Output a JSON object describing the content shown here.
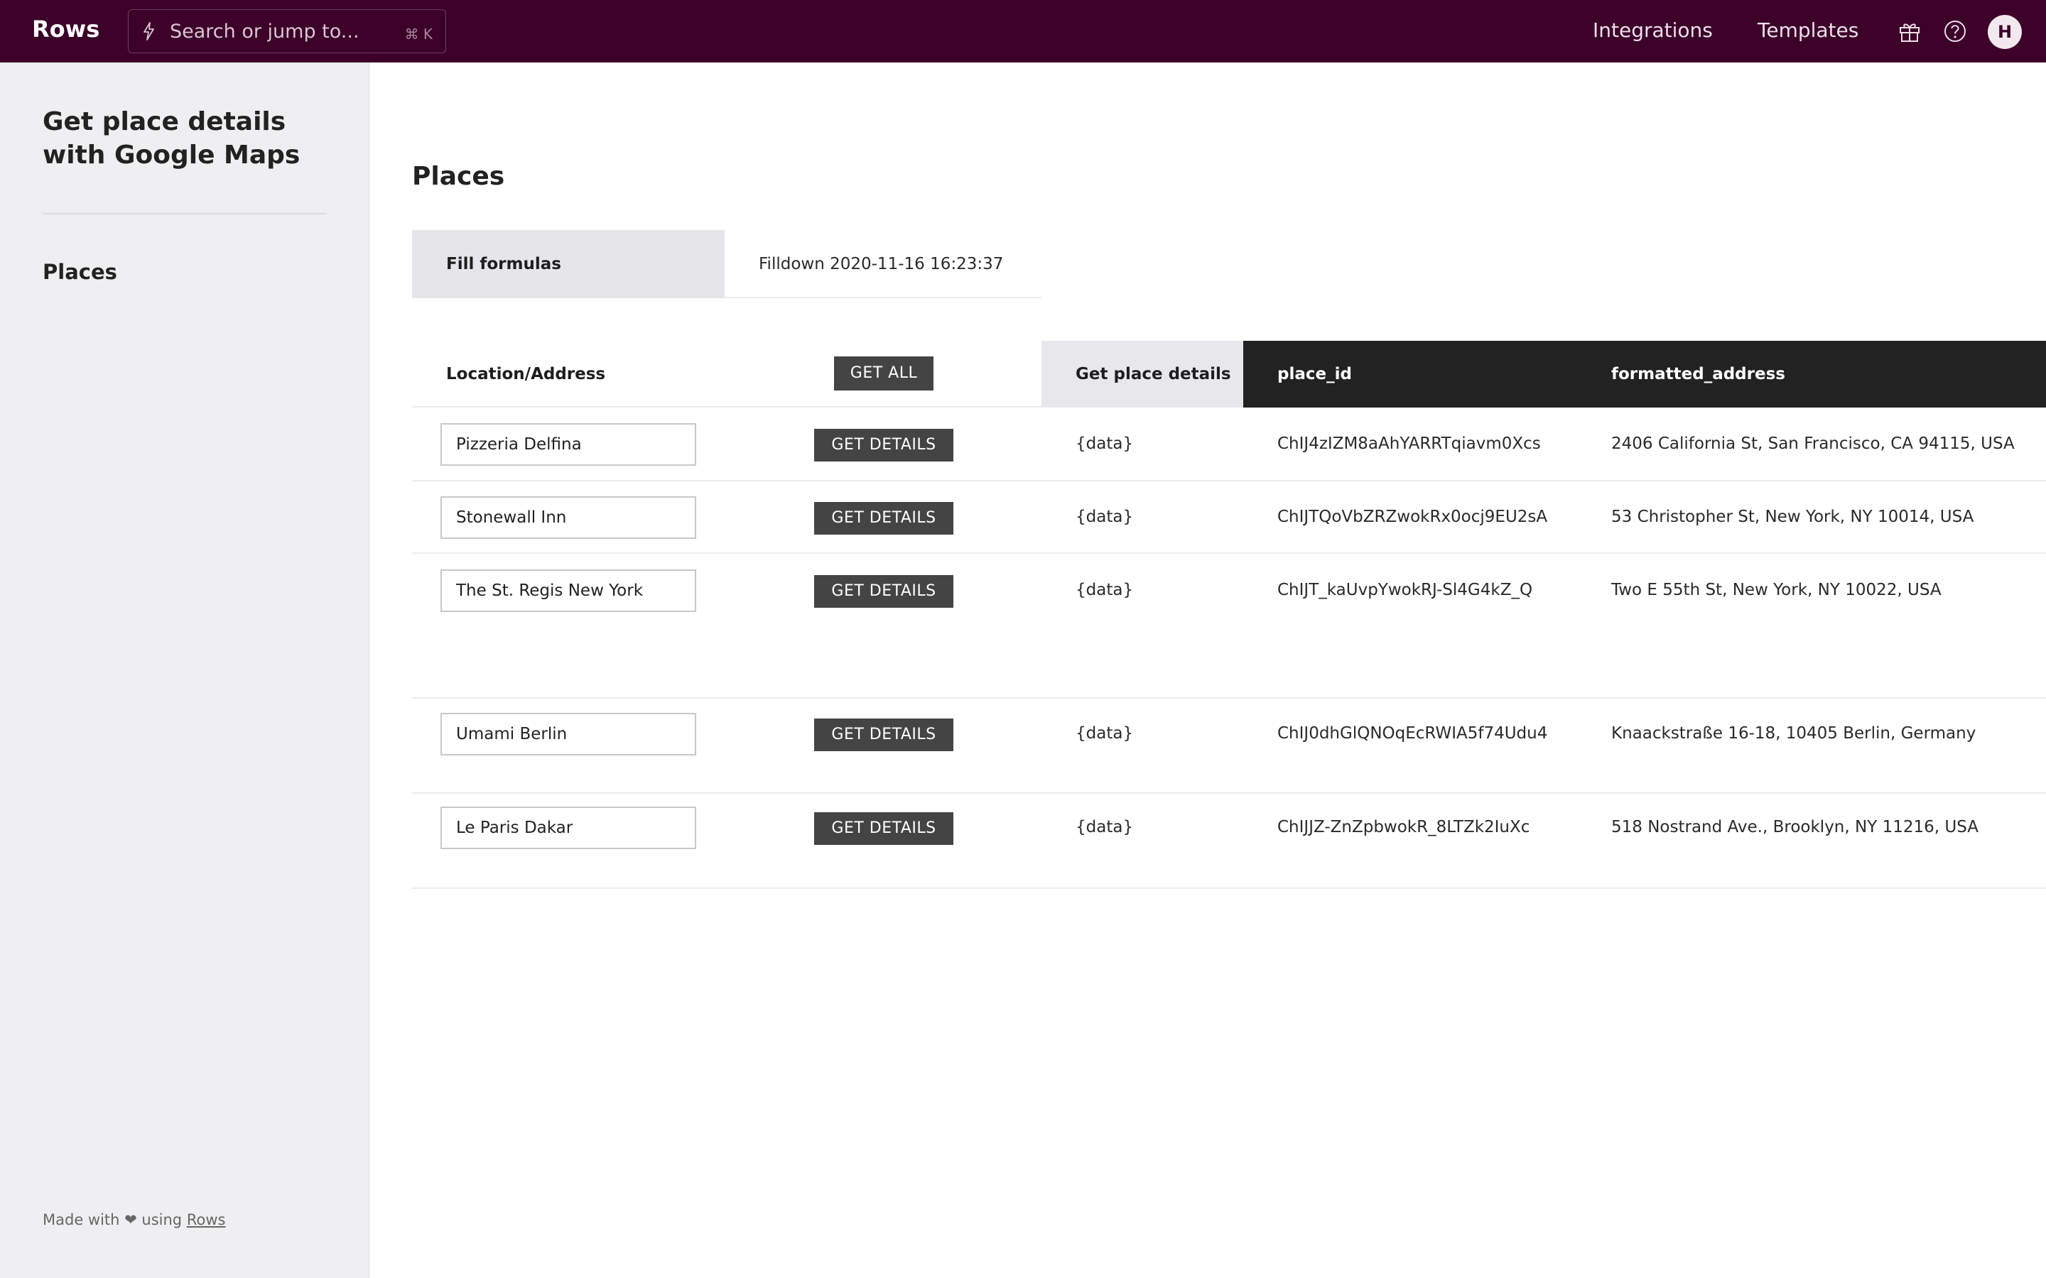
{
  "topbar": {
    "logo": "Rows",
    "search_placeholder": "Search or jump to...",
    "search_shortcut": "⌘ K",
    "nav": [
      "Integrations",
      "Templates"
    ],
    "avatar_initial": "H",
    "bg_color": "#3c0029"
  },
  "sidebar": {
    "title": "Get place details with Google Maps",
    "items": [
      "Places"
    ],
    "footer_prefix": "Made with ❤ using",
    "footer_link": "Rows"
  },
  "main": {
    "section_title": "Places",
    "fill_formulas_label": "Fill formulas",
    "filldown_text": "Filldown 2020-11-16 16:23:37",
    "columns": {
      "location": "Location/Address",
      "get_all": "GET ALL",
      "get_details": "Get place details",
      "place_id": "place_id",
      "formatted_address": "formatted_address"
    },
    "button_label": "GET DETAILS",
    "rows": [
      {
        "location": "Pizzeria Delfina",
        "data": "{data}",
        "place_id": "ChIJ4zIZM8aAhYARRTqiavm0Xcs",
        "address": "2406 California St, San Francisco, CA 94115, USA"
      },
      {
        "location": "Stonewall Inn",
        "data": "{data}",
        "place_id": "ChIJTQoVbZRZwokRx0ocj9EU2sA",
        "address": "53 Christopher St, New York, NY 10014, USA"
      },
      {
        "location": "The St. Regis New York",
        "data": "{data}",
        "place_id": "ChIJT_kaUvpYwokRJ-Sl4G4kZ_Q",
        "address": "Two E 55th St, New York, NY 10022, USA"
      },
      {
        "location": "Umami Berlin",
        "data": "{data}",
        "place_id": "ChIJ0dhGlQNOqEcRWIA5f74Udu4",
        "address": "Knaackstraße 16-18, 10405 Berlin, Germany"
      },
      {
        "location": "Le Paris Dakar",
        "data": "{data}",
        "place_id": "ChIJJZ-ZnZpbwokR_8LTZk2IuXc",
        "address": "518 Nostrand Ave., Brooklyn, NY 11216, USA"
      }
    ]
  }
}
